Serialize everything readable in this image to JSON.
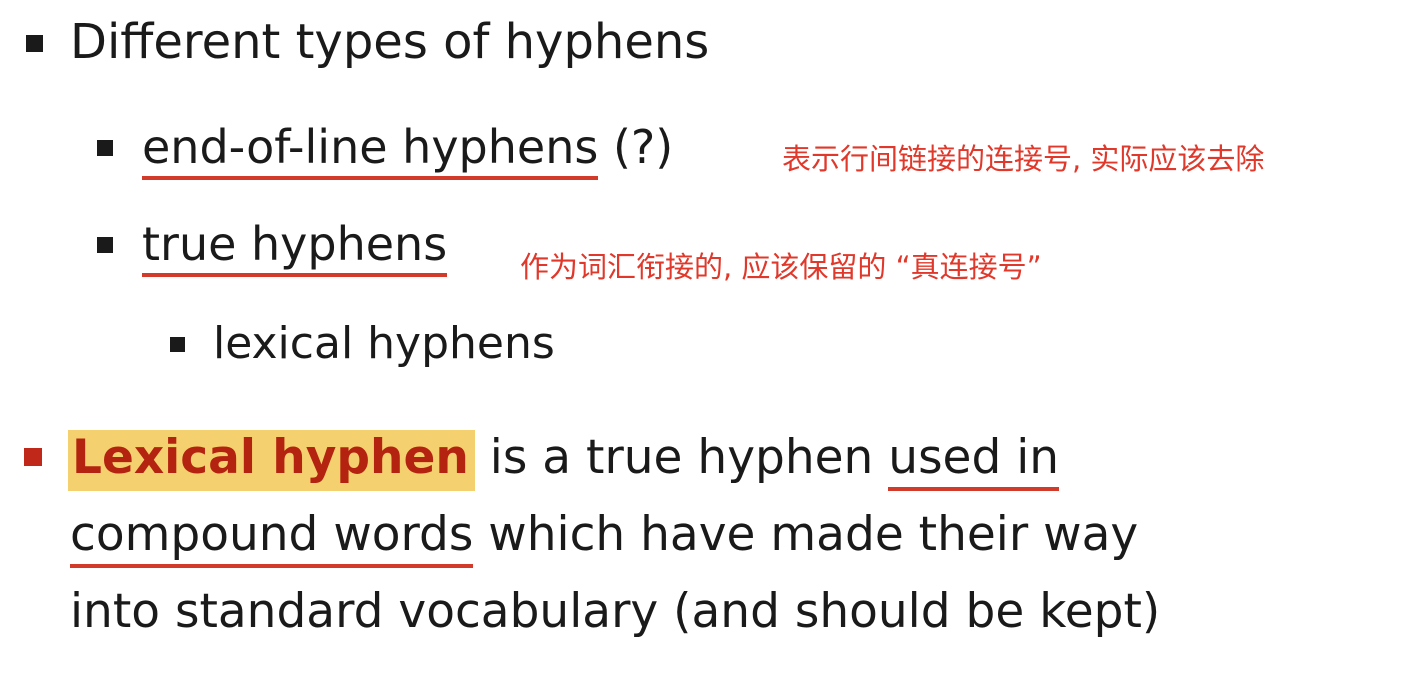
{
  "slide": {
    "item1": {
      "text": "Different types of hyphens"
    },
    "item2": {
      "term": "end-of-line hyphens",
      "suffix": " (?)",
      "note": "表示行间链接的连接号, 实际应该去除"
    },
    "item3": {
      "term": "true hyphens",
      "note": "作为词汇衔接的, 应该保留的 “真连接号”"
    },
    "item4": {
      "text": "lexical hyphens"
    },
    "definition": {
      "highlight": "Lexical hyphen",
      "part1": " is a true hyphen ",
      "underline1": "used in",
      "underline2": "compound words",
      "part2": " which have made their way",
      "line3": "into standard vocabulary (and should be kept)"
    }
  },
  "colors": {
    "text": "#1a1a1a",
    "bullet_dark": "#1a1a1a",
    "bullet_red": "#c0281a",
    "underline": "#d23a2a",
    "note": "#e0382a",
    "highlight_bg": "#f4d06f",
    "highlight_text": "#b3230f"
  }
}
